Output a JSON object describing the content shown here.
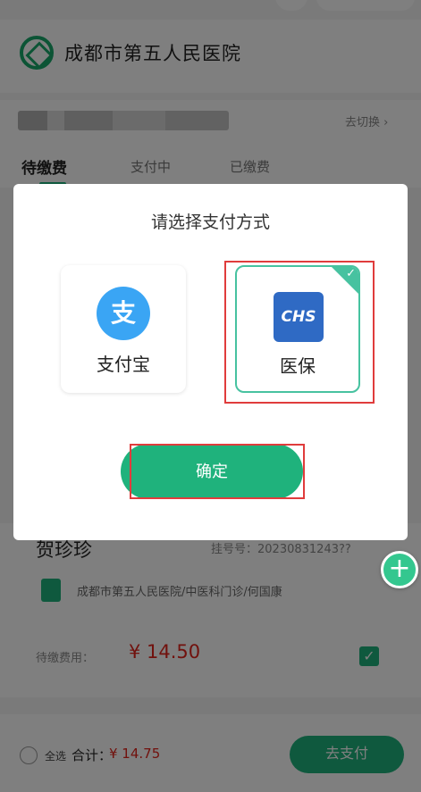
{
  "header": {
    "hospital_name": "成都市第五人民医院",
    "logo_icon": "hospital-logo-icon"
  },
  "patient_card": {
    "switch_label": "去切换 ›"
  },
  "tabs": [
    {
      "label": "待缴费",
      "active": true
    },
    {
      "label": "支付中",
      "active": false
    },
    {
      "label": "已缴费",
      "active": false
    }
  ],
  "modal": {
    "title": "请选择支付方式",
    "methods": [
      {
        "label": "支付宝",
        "icon": "alipay-icon",
        "icon_text": "支",
        "selected": false
      },
      {
        "label": "医保",
        "icon": "chs-icon",
        "icon_text": "CHS",
        "selected": true
      }
    ],
    "confirm_label": "确定"
  },
  "order": {
    "patient_name": "贺珍珍",
    "registration_no": "挂号号：20230831243??",
    "department": "成都市第五人民医院/中医科门诊/何国康",
    "fee_label": "待缴费用：",
    "fee_amount": "¥ 14.50"
  },
  "bottom_bar": {
    "select_all": "全选",
    "total_label": "合计：",
    "total_amount": "¥ 14.75",
    "pay_button": "去支付"
  },
  "colors": {
    "accent": "#1fb27c",
    "price": "#e2231a",
    "highlight": "#e03c3c"
  }
}
